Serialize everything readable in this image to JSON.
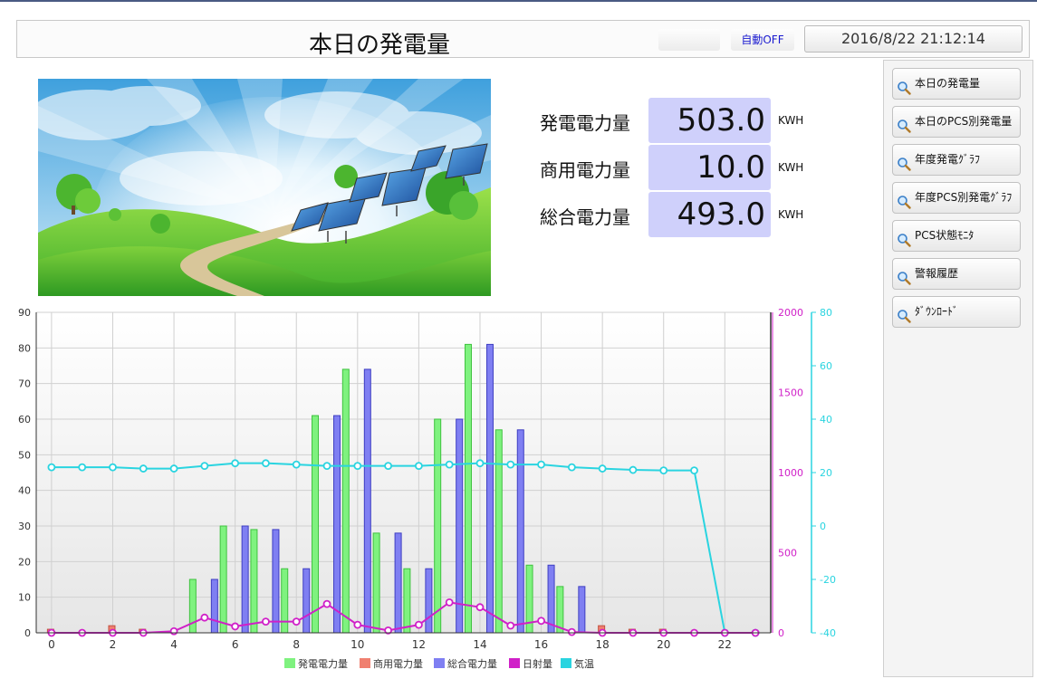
{
  "header": {
    "title": "本日の発電量",
    "auto_label": "自動OFF",
    "datetime": "2016/8/22 21:12:14"
  },
  "metrics": [
    {
      "label": "発電電力量",
      "value": "503.0",
      "unit": "KWH"
    },
    {
      "label": "商用電力量",
      "value": "10.0",
      "unit": "KWH"
    },
    {
      "label": "総合電力量",
      "value": "493.0",
      "unit": "KWH"
    }
  ],
  "sidebar": {
    "icon": "search-icon",
    "items": [
      {
        "label": "本日の発電量"
      },
      {
        "label": "本日のPCS別発電量"
      },
      {
        "label": "年度発電ｸﾞﾗﾌ"
      },
      {
        "label": "年度PCS別発電ｸﾞﾗﾌ"
      },
      {
        "label": "PCS状態ﾓﾆﾀ"
      },
      {
        "label": "警報履歴"
      },
      {
        "label": "ﾀﾞｳﾝﾛｰﾄﾞ"
      }
    ]
  },
  "colors": {
    "metric_box": "#cfd0fb",
    "generation": "#7ff27f",
    "commercial": "#f08070",
    "total": "#7f7ff2",
    "solar": "#d020c8",
    "temperature": "#2ad4e0"
  },
  "chart_data": {
    "type": "bar",
    "x": [
      0,
      1,
      2,
      3,
      4,
      5,
      6,
      7,
      8,
      9,
      10,
      11,
      12,
      13,
      14,
      15,
      16,
      17,
      18,
      19,
      20,
      21,
      22,
      23
    ],
    "xlim": [
      -0.5,
      23.5
    ],
    "x_ticks": [
      0,
      2,
      4,
      6,
      8,
      10,
      12,
      14,
      16,
      18,
      20,
      22
    ],
    "y_left": {
      "range": [
        0,
        90
      ],
      "ticks": [
        0,
        10,
        20,
        30,
        40,
        50,
        60,
        70,
        80,
        90
      ]
    },
    "y_right_solar": {
      "range": [
        0,
        2000
      ],
      "ticks": [
        0,
        500,
        1000,
        1500,
        2000
      ]
    },
    "y_right_temp": {
      "range": [
        -40,
        80
      ],
      "ticks": [
        -40,
        -20,
        0,
        20,
        40,
        60,
        80
      ]
    },
    "grid": true,
    "legend_position": "bottom",
    "series": [
      {
        "name": "発電電力量",
        "kind": "bar",
        "axis": "left",
        "values": [
          0,
          0,
          0,
          0,
          0,
          15,
          30,
          29,
          18,
          61,
          74,
          28,
          18,
          60,
          81,
          57,
          19,
          13,
          0,
          0,
          0,
          0,
          0,
          0
        ]
      },
      {
        "name": "商用電力量",
        "kind": "bar",
        "axis": "left",
        "values": [
          1,
          0,
          2,
          1,
          0,
          0,
          0,
          0,
          0,
          0,
          0,
          0,
          0,
          0,
          0,
          0,
          0,
          0,
          2,
          1,
          1,
          0,
          0,
          0
        ]
      },
      {
        "name": "総合電力量",
        "kind": "bar",
        "axis": "left",
        "values": [
          0,
          0,
          0,
          0,
          0,
          15,
          30,
          29,
          18,
          61,
          74,
          28,
          18,
          60,
          81,
          57,
          19,
          13,
          0,
          0,
          0,
          0,
          0,
          0
        ]
      },
      {
        "name": "日射量",
        "kind": "line",
        "axis": "right_solar",
        "values": [
          0,
          0,
          0,
          0,
          10,
          95,
          40,
          70,
          70,
          180,
          50,
          15,
          50,
          190,
          160,
          45,
          75,
          5,
          0,
          0,
          0,
          0,
          0,
          0
        ]
      },
      {
        "name": "気温",
        "kind": "line",
        "axis": "right_temp",
        "values": [
          22,
          22,
          22,
          21.5,
          21.5,
          22.5,
          23.5,
          23.5,
          23,
          22.5,
          22.5,
          22.5,
          22.5,
          23,
          23.5,
          23,
          23,
          22,
          21.5,
          21,
          20.8,
          20.8,
          -40,
          -40
        ]
      }
    ]
  }
}
